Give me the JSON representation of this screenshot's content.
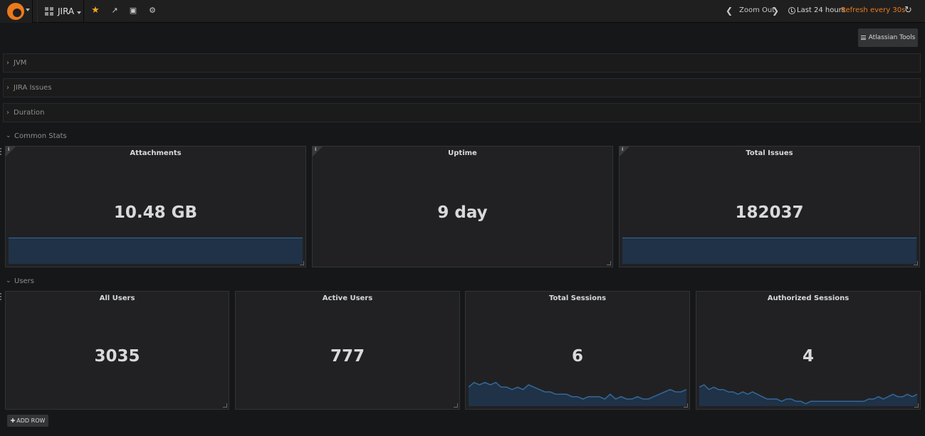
{
  "nav": {
    "dashboard_title": "JIRA",
    "zoom_out": "Zoom Out",
    "time_range": "Last 24 hours",
    "refresh": "Refresh every 30s"
  },
  "atlassian_tools": "Atlassian Tools",
  "rows": {
    "jvm": "JVM",
    "jira_issues": "JIRA Issues",
    "duration": "Duration",
    "common_stats": "Common Stats",
    "users": "Users"
  },
  "common_stats": [
    {
      "title": "Attachments",
      "value": "10.48 GB"
    },
    {
      "title": "Uptime",
      "value": "9 day"
    },
    {
      "title": "Total Issues",
      "value": "182037"
    }
  ],
  "users": [
    {
      "title": "All Users",
      "value": "3035"
    },
    {
      "title": "Active Users",
      "value": "777"
    },
    {
      "title": "Total Sessions",
      "value": "6"
    },
    {
      "title": "Authorized Sessions",
      "value": "4"
    }
  ],
  "sparklines": {
    "total_sessions": [
      8,
      10,
      9,
      10,
      9,
      10,
      8,
      8,
      7,
      8,
      7,
      9,
      8,
      7,
      6,
      6,
      5,
      5,
      5,
      4,
      4,
      3,
      4,
      4,
      4,
      3,
      5,
      3,
      4,
      3,
      3,
      4,
      3,
      3,
      4,
      5,
      6,
      7,
      6,
      6,
      7
    ],
    "authorized_sessions": [
      8,
      9,
      7,
      8,
      7,
      7,
      6,
      6,
      5,
      6,
      5,
      6,
      5,
      4,
      3,
      3,
      3,
      2,
      3,
      3,
      2,
      2,
      1,
      2,
      2,
      2,
      2,
      2,
      2,
      2,
      2,
      2,
      2,
      2,
      2,
      3,
      3,
      4,
      3,
      4,
      5,
      4,
      4,
      5,
      4,
      5
    ]
  },
  "add_row": "ADD ROW"
}
